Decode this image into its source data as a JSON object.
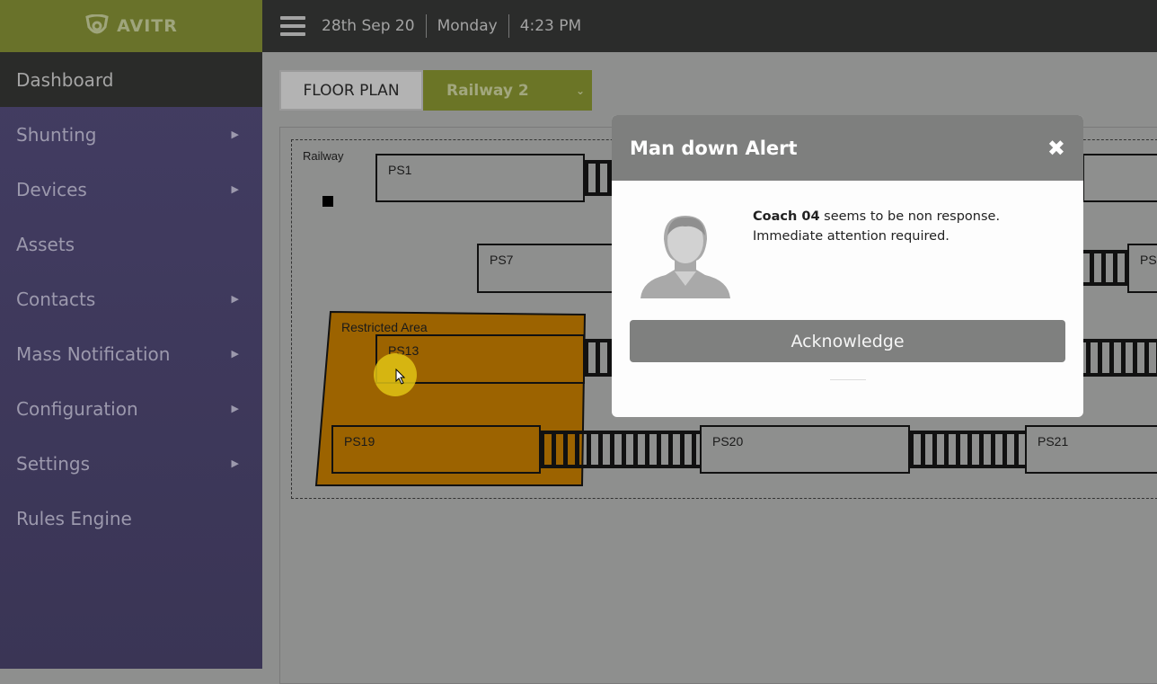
{
  "brand": {
    "name": "AVITR"
  },
  "sidebar": {
    "items": [
      {
        "label": "Dashboard",
        "active": true,
        "submenu": false
      },
      {
        "label": "Shunting",
        "submenu": true
      },
      {
        "label": "Devices",
        "submenu": true
      },
      {
        "label": "Assets",
        "submenu": false
      },
      {
        "label": "Contacts",
        "submenu": true
      },
      {
        "label": "Mass Notification",
        "submenu": true
      },
      {
        "label": "Configuration",
        "submenu": true
      },
      {
        "label": "Settings",
        "submenu": true
      },
      {
        "label": "Rules Engine",
        "submenu": false
      }
    ]
  },
  "topbar": {
    "date": "28th Sep 20",
    "day": "Monday",
    "time": "4:23 PM"
  },
  "tabs": {
    "floor_plan": "FLOOR PLAN",
    "selected_site": "Railway 2"
  },
  "floorplan": {
    "region_label": "Railway",
    "restricted_label": "Restricted Area",
    "platforms": [
      "PS1",
      "PS7",
      "PS13",
      "PS19",
      "PS20",
      "PS21",
      "PS"
    ]
  },
  "modal": {
    "title": "Man down Alert",
    "subject": "Coach 04",
    "message": " seems to be non response.",
    "message2": "Immediate attention required.",
    "button": "Acknowledge"
  },
  "colors": {
    "brand": "#6b7526",
    "sidebar": "#433d63",
    "restricted": "#9c6300"
  }
}
